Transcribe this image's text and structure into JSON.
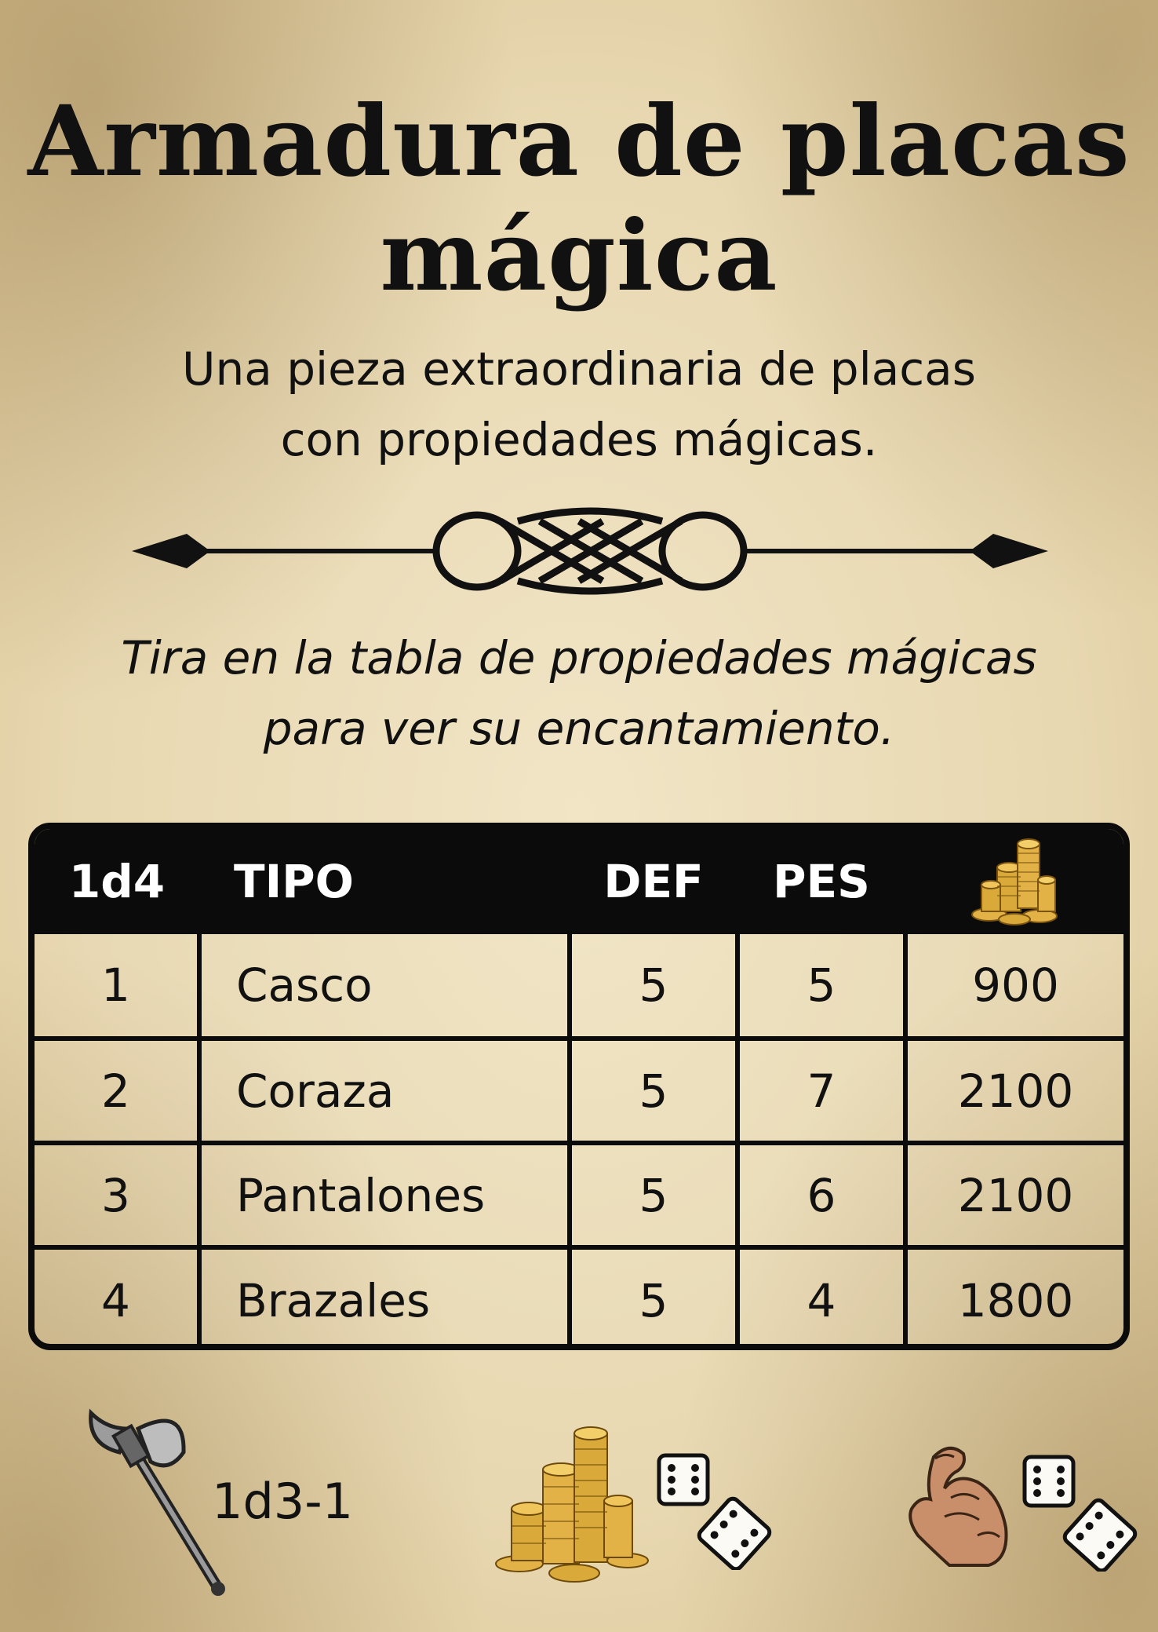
{
  "card": {
    "title_line1": "Armadura de placas",
    "title_line2": "mágica",
    "subtitle_line1": "Una pieza extraordinaria de placas",
    "subtitle_line2": "con propiedades mágicas.",
    "instruction_line1": "Tira en la tabla de propiedades mágicas",
    "instruction_line2": "para ver su encantamiento."
  },
  "table": {
    "headers": [
      "1d4",
      "TIPO",
      "DEF",
      "PES"
    ],
    "price_header_icon": "gold-coins-icon",
    "rows": [
      {
        "roll": "1",
        "type": "Casco",
        "def": "5",
        "pes": "5",
        "price": "900"
      },
      {
        "roll": "2",
        "type": "Coraza",
        "def": "5",
        "pes": "7",
        "price": "2100"
      },
      {
        "roll": "3",
        "type": "Pantalones",
        "def": "5",
        "pes": "6",
        "price": "2100"
      },
      {
        "roll": "4",
        "type": "Brazales",
        "def": "5",
        "pes": "4",
        "price": "1800"
      }
    ]
  },
  "footer": {
    "damage_icon": "battle-axe-icon",
    "damage": "1d3-1",
    "loot_icons": [
      "gold-coins-icon",
      "dice-icon"
    ],
    "strength_icons": [
      "flexed-arm-icon",
      "dice-icon"
    ]
  },
  "colors": {
    "parchment": "#e8d8b1",
    "ink": "#111111",
    "gold": "#d9a93a"
  }
}
